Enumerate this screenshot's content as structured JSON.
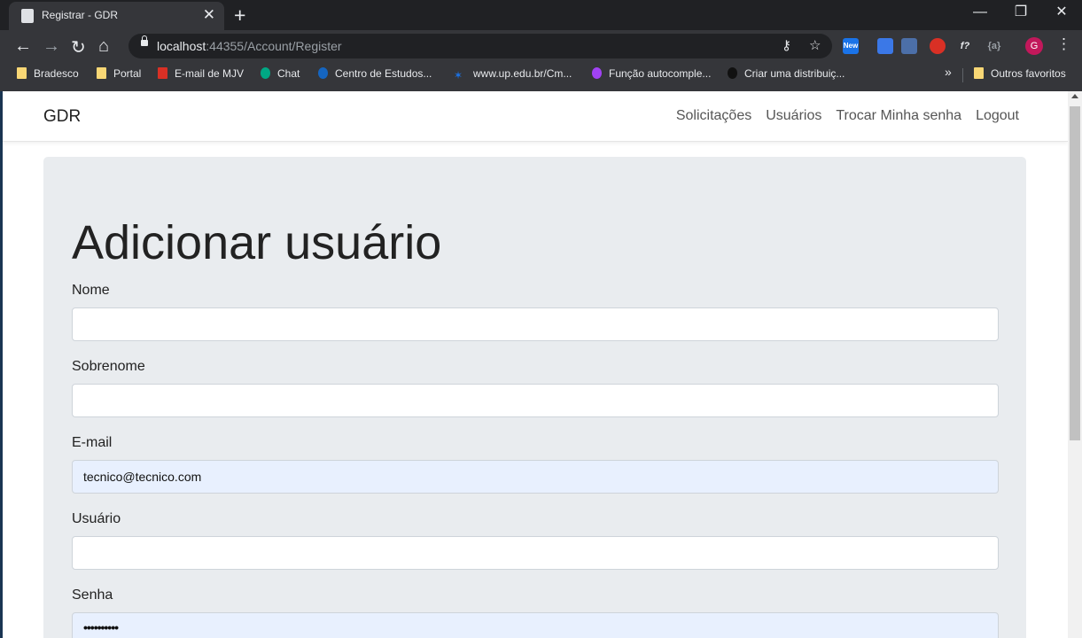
{
  "browser": {
    "tab_title": "Registrar - GDR",
    "tab_close": "✕",
    "new_tab": "+",
    "window_buttons": {
      "minimize": "—",
      "restore": "❐",
      "close": "✕"
    },
    "url_host": "localhost",
    "url_rest": ":44355/Account/Register",
    "extension_badge": "New",
    "extension_f": "f?",
    "profile_initial": "G",
    "overflow": "»",
    "menu": "⋮"
  },
  "bookmarks": [
    {
      "label": "Bradesco",
      "icon": "folder-icon"
    },
    {
      "label": "Portal",
      "icon": "folder-icon"
    },
    {
      "label": "E-mail de MJV",
      "icon": "gmail-icon"
    },
    {
      "label": "Chat",
      "icon": "chat-icon"
    },
    {
      "label": "Centro de Estudos...",
      "icon": "site-icon"
    },
    {
      "label": "www.up.edu.br/Cm...",
      "icon": "star-icon"
    },
    {
      "label": "Função autocomple...",
      "icon": "site-icon"
    },
    {
      "label": "Criar uma distribuiç...",
      "icon": "site-icon"
    },
    {
      "label": "Outros favoritos",
      "icon": "folder-icon"
    }
  ],
  "navbar": {
    "brand": "GDR",
    "links": [
      "Solicitações",
      "Usuários",
      "Trocar Minha senha",
      "Logout"
    ]
  },
  "form": {
    "heading": "Adicionar usuário",
    "fields": [
      {
        "label": "Nome",
        "value": ""
      },
      {
        "label": "Sobrenome",
        "value": ""
      },
      {
        "label": "E-mail",
        "value": "tecnico@tecnico.com"
      },
      {
        "label": "Usuário",
        "value": ""
      },
      {
        "label": "Senha",
        "value": "••••••••••"
      }
    ]
  },
  "colors": {
    "chrome_dark": "#202124",
    "toolbar": "#35363a",
    "jumbotron": "#e9ecef",
    "autofill": "#e8f0fe"
  }
}
